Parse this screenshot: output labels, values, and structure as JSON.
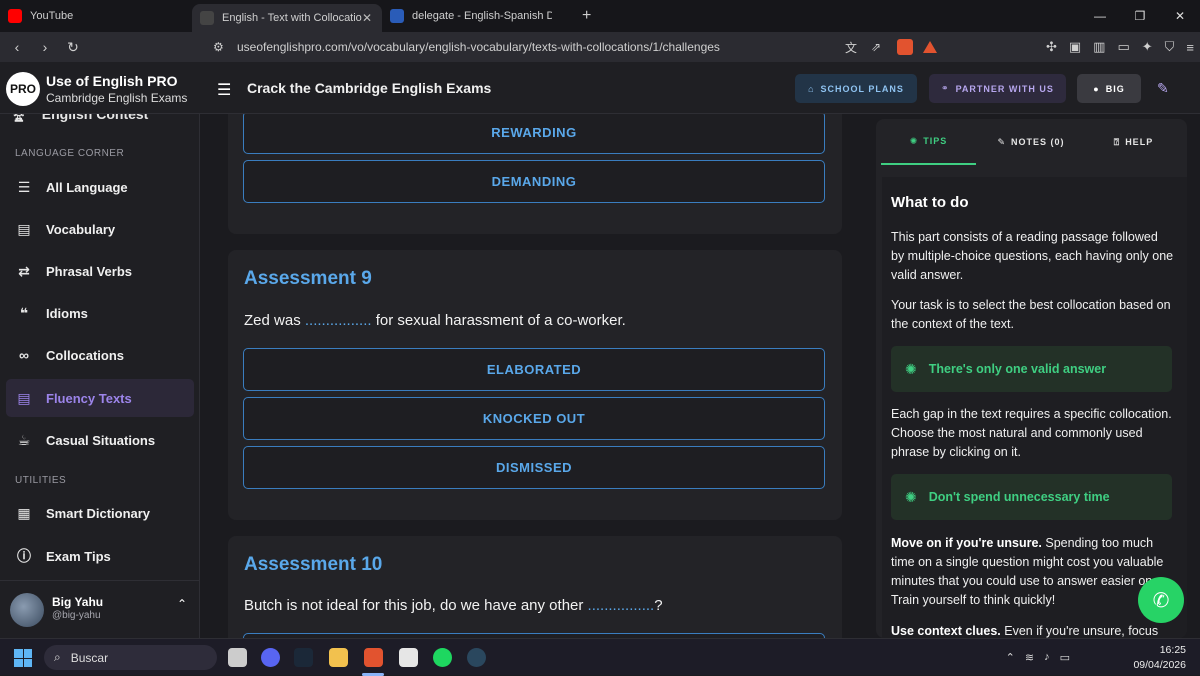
{
  "browser": {
    "tabs": [
      {
        "title": "YouTube"
      },
      {
        "title": "English - Text with Collocations | Use of English PRO"
      },
      {
        "title": "delegate - English-Spanish Dictionary"
      }
    ],
    "url": "useofenglishpro.com/vo/vocabulary/english-vocabulary/texts-with-collocations/1/challenges",
    "new_tab": "+",
    "brave_shield_count": "0"
  },
  "site": {
    "logo": "PRO",
    "brand": "Use of English PRO",
    "brand_sub": "Cambridge English Exams",
    "title": "Crack the Cambridge English Exams",
    "buttons": {
      "school": "SCHOOL PLANS",
      "partner": "PARTNER WITH US",
      "user": "BIG"
    }
  },
  "sidebar": {
    "cut_item": "English Contest",
    "sections": [
      {
        "label": "LANGUAGE CORNER"
      },
      {
        "label": "UTILITIES"
      }
    ],
    "items": [
      {
        "label": "All Language",
        "icon": "list-icon"
      },
      {
        "label": "Vocabulary",
        "icon": "book-icon"
      },
      {
        "label": "Phrasal Verbs",
        "icon": "swap-icon"
      },
      {
        "label": "Idioms",
        "icon": "quote-icon"
      },
      {
        "label": "Collocations",
        "icon": "link-icon"
      },
      {
        "label": "Fluency Texts",
        "icon": "document-icon",
        "active": true
      },
      {
        "label": "Casual Situations",
        "icon": "coffee-icon"
      },
      {
        "label": "Smart Dictionary",
        "icon": "dictionary-icon"
      },
      {
        "label": "Exam Tips",
        "icon": "info-icon"
      }
    ],
    "profile": {
      "name": "Big Yahu",
      "handle": "@big-yahu"
    }
  },
  "main": {
    "prev_options": [
      "REWARDING",
      "DEMANDING"
    ],
    "assessment9": {
      "title": "Assessment 9",
      "q_before": "Zed was ",
      "q_gap": "................",
      "q_after": " for sexual harassment of a co-worker.",
      "options": [
        "ELABORATED",
        "KNOCKED OUT",
        "DISMISSED"
      ]
    },
    "assessment10": {
      "title": "Assessment 10",
      "q_before": "Butch is not ideal for this job, do we have any other ",
      "q_gap": "................",
      "q_after": "?"
    }
  },
  "panel": {
    "tabs": {
      "tips": "TIPS",
      "notes": "NOTES (0)",
      "help": "HELP"
    },
    "heading": "What to do",
    "p1": "This part consists of a reading passage followed by multiple-choice questions, each having only one valid answer.",
    "p2": "Your task is to select the best collocation based on the context of the text.",
    "tip1": "There's only one valid answer",
    "p3": "Each gap in the text requires a specific collocation. Choose the most natural and commonly used phrase by clicking on it.",
    "tip2": "Don't spend unnecessary time",
    "p4_bold": "Move on if you're unsure.",
    "p4_rest": " Spending too much time on a single question might cost you valuable minutes that you could use to answer easier ones. Train yourself to think quickly!",
    "p5_bold": "Use context clues.",
    "p5_rest": " Even if you're unsure, focus"
  },
  "taskbar": {
    "search": "Buscar",
    "time": "16:25",
    "date": "09/04/2026"
  },
  "colors": {
    "accent_blue": "#5aa8ea",
    "accent_green": "#3fcf82",
    "accent_purple": "#9c84ea"
  }
}
